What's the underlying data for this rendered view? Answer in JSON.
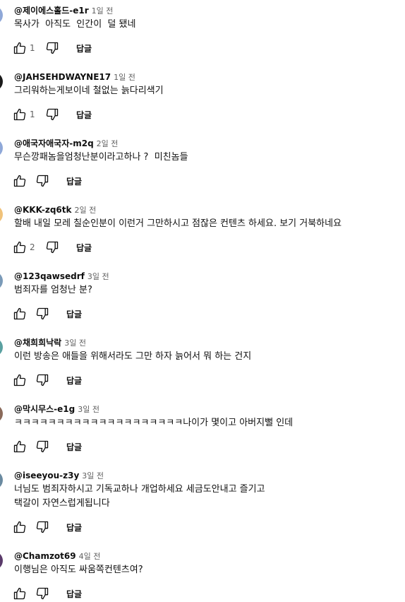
{
  "comments": [
    {
      "author": "@제이에스홀드-e1r",
      "time": "1일 전",
      "text": "목사가  아직도  인간이  덜 됐네",
      "likes": "1",
      "reply": "답글",
      "avatar_color": "#8fa8d8"
    },
    {
      "author": "@JAHSEHDWAYNE17",
      "time": "1일 전",
      "text": "그리워하는게보이네 철없는 늙다리색기",
      "likes": "1",
      "reply": "답글",
      "avatar_color": "#1a1a1a"
    },
    {
      "author": "@애국자애국자-m2q",
      "time": "2일 전",
      "text": "무슨깡패놈을엄청난분이라고하나 ?  미친놈들",
      "likes": "",
      "reply": "답글",
      "avatar_color": "#8fa8d8"
    },
    {
      "author": "@KKK-zq6tk",
      "time": "2일 전",
      "text": "할배 내일 모레 칠순인분이 이런거 그만하시고 점잖은 컨텐츠 하세요. 보기 거북하네요",
      "likes": "2",
      "reply": "답글",
      "avatar_color": "#f0c27a"
    },
    {
      "author": "@123qawsedrf",
      "time": "3일 전",
      "text": "범죄자를 엄청난 분?",
      "likes": "",
      "reply": "답글",
      "avatar_color": "#7a9ab8"
    },
    {
      "author": "@채희희낙락",
      "time": "3일 전",
      "text": "이런 방송은 애들을 위해서라도 그만 하자 늙어서 뭐 하는 건지",
      "likes": "",
      "reply": "답글",
      "avatar_color": "#5aa0a0"
    },
    {
      "author": "@막시무스-e1g",
      "time": "3일 전",
      "text": "ㅋㅋㅋㅋㅋㅋㅋㅋㅋㅋㅋㅋㅋㅋㅋㅋㅋㅋㅋㅋ나이가 몇이고 아버지뻘 인데",
      "likes": "",
      "reply": "답글",
      "avatar_color": "#8a6a5a"
    },
    {
      "author": "@iseeyou-z3y",
      "time": "3일 전",
      "text": "너님도 범죄자하시고 기독교하나 개업하세요 세금도안내고 즐기고\n택갈이 자연스럽게됩니다",
      "likes": "",
      "reply": "답글",
      "avatar_color": "#6a8aa0"
    },
    {
      "author": "@Chamzot69",
      "time": "4일 전",
      "text": "이행님은 아직도 싸움쪽컨텐츠여?",
      "likes": "",
      "reply": "답글",
      "avatar_color": "#5a3a6a"
    }
  ]
}
